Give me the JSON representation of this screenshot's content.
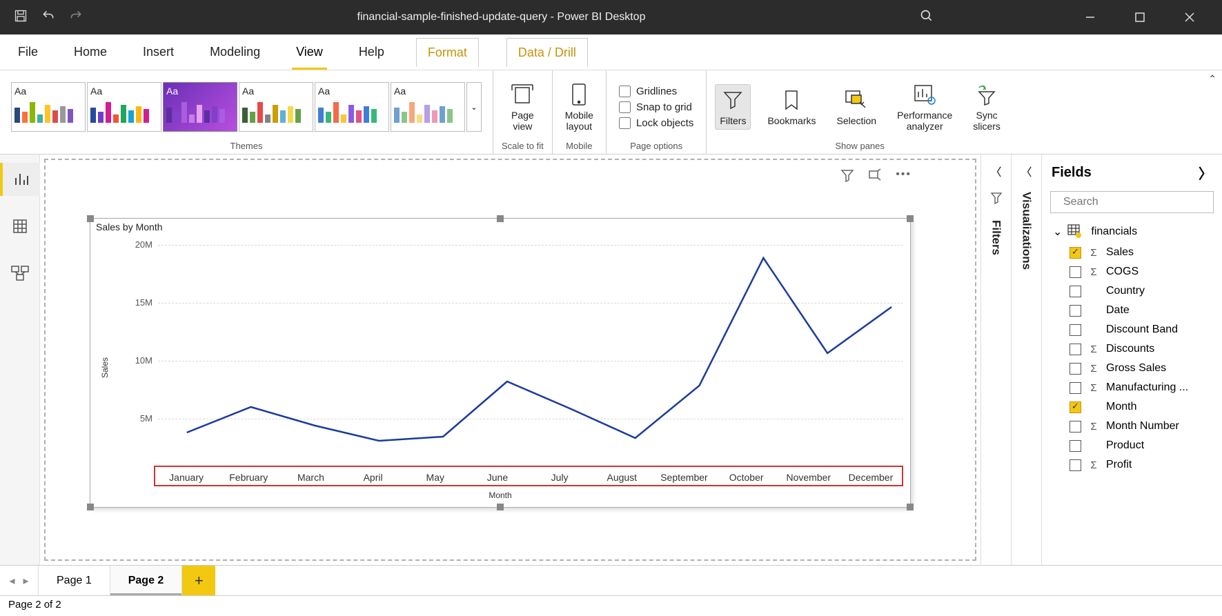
{
  "titlebar": {
    "app_title": "financial-sample-finished-update-query - Power BI Desktop"
  },
  "menu": {
    "items": [
      "File",
      "Home",
      "Insert",
      "Modeling",
      "View",
      "Help",
      "Format",
      "Data / Drill"
    ],
    "active": "View"
  },
  "ribbon": {
    "themes_label": "Themes",
    "scale_label": "Scale to fit",
    "mobile_label": "Mobile",
    "page_options_label": "Page options",
    "show_panes_label": "Show panes",
    "page_view": "Page\nview",
    "mobile_layout": "Mobile\nlayout",
    "gridlines": "Gridlines",
    "snap": "Snap to grid",
    "lock": "Lock objects",
    "filters": "Filters",
    "bookmarks": "Bookmarks",
    "selection": "Selection",
    "perf": "Performance\nanalyzer",
    "sync": "Sync\nslicers"
  },
  "panes": {
    "filters": "Filters",
    "visualizations": "Visualizations",
    "fields": "Fields"
  },
  "search": {
    "placeholder": "Search"
  },
  "fields": {
    "table": "financials",
    "items": [
      {
        "label": "Sales",
        "checked": true,
        "sigma": true
      },
      {
        "label": "COGS",
        "checked": false,
        "sigma": true
      },
      {
        "label": "Country",
        "checked": false,
        "sigma": false
      },
      {
        "label": "Date",
        "checked": false,
        "sigma": false
      },
      {
        "label": "Discount Band",
        "checked": false,
        "sigma": false
      },
      {
        "label": "Discounts",
        "checked": false,
        "sigma": true
      },
      {
        "label": "Gross Sales",
        "checked": false,
        "sigma": true
      },
      {
        "label": "Manufacturing ...",
        "checked": false,
        "sigma": true
      },
      {
        "label": "Month",
        "checked": true,
        "sigma": false
      },
      {
        "label": "Month Number",
        "checked": false,
        "sigma": true
      },
      {
        "label": "Product",
        "checked": false,
        "sigma": false
      },
      {
        "label": "Profit",
        "checked": false,
        "sigma": true
      }
    ]
  },
  "pages": {
    "tabs": [
      "Page 1",
      "Page 2"
    ],
    "active": "Page 2"
  },
  "status": {
    "text": "Page 2 of 2"
  },
  "chart_data": {
    "type": "line",
    "title": "Sales by Month",
    "xlabel": "Month",
    "ylabel": "Sales",
    "ylim": [
      0,
      20000000
    ],
    "yticks": [
      "5M",
      "10M",
      "15M",
      "20M"
    ],
    "categories": [
      "January",
      "February",
      "March",
      "April",
      "May",
      "June",
      "July",
      "August",
      "September",
      "October",
      "November",
      "December"
    ],
    "values": [
      5000000,
      7200000,
      5600000,
      4300000,
      4600000,
      9400000,
      7000000,
      4500000,
      9000000,
      20000000,
      11800000,
      15800000
    ]
  }
}
